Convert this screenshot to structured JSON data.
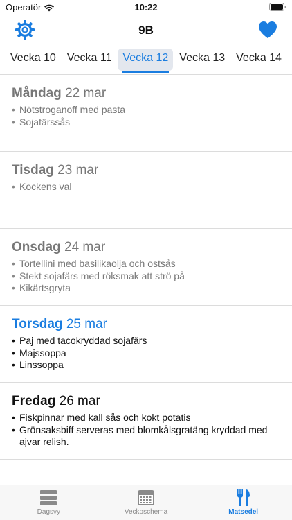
{
  "status": {
    "carrier": "Operatör",
    "time": "10:22"
  },
  "nav": {
    "title": "9B",
    "left_icon": "settings-gear-icon",
    "right_icon": "heart-icon",
    "accent_color": "#1a7de0"
  },
  "weeks": {
    "tabs": [
      {
        "label": "Vecka 10"
      },
      {
        "label": "Vecka 11"
      },
      {
        "label": "Vecka 12"
      },
      {
        "label": "Vecka 13"
      },
      {
        "label": "Vecka 14"
      }
    ],
    "selected": "Vecka 12"
  },
  "days": [
    {
      "name": "Måndag",
      "date": "22 mar",
      "dishes": [
        "Nötstroganoff med pasta",
        "Sojafärssås"
      ]
    },
    {
      "name": "Tisdag",
      "date": "23 mar",
      "dishes": [
        "Kockens val"
      ]
    },
    {
      "name": "Onsdag",
      "date": "24 mar",
      "dishes": [
        "Tortellini med basilikaolja och ostsås",
        "Stekt sojafärs med röksmak att strö på",
        "Kikärtsgryta"
      ]
    },
    {
      "name": "Torsdag",
      "date": "25 mar",
      "dishes": [
        "Paj med tacokryddad sojafärs",
        "Majssoppa",
        "Linssoppa"
      ]
    },
    {
      "name": "Fredag",
      "date": "26 mar",
      "dishes": [
        "Fiskpinnar med kall sås och kokt potatis",
        "Grönsaksbiff serveras med blomkålsgratäng kryddad med ajvar relish."
      ]
    }
  ],
  "tabbar": {
    "items": [
      {
        "label": "Dagsvy",
        "icon": "day-view-icon"
      },
      {
        "label": "Veckoschema",
        "icon": "week-schedule-icon"
      },
      {
        "label": "Matsedel",
        "icon": "fork-knife-icon"
      }
    ],
    "selected": "Matsedel"
  }
}
